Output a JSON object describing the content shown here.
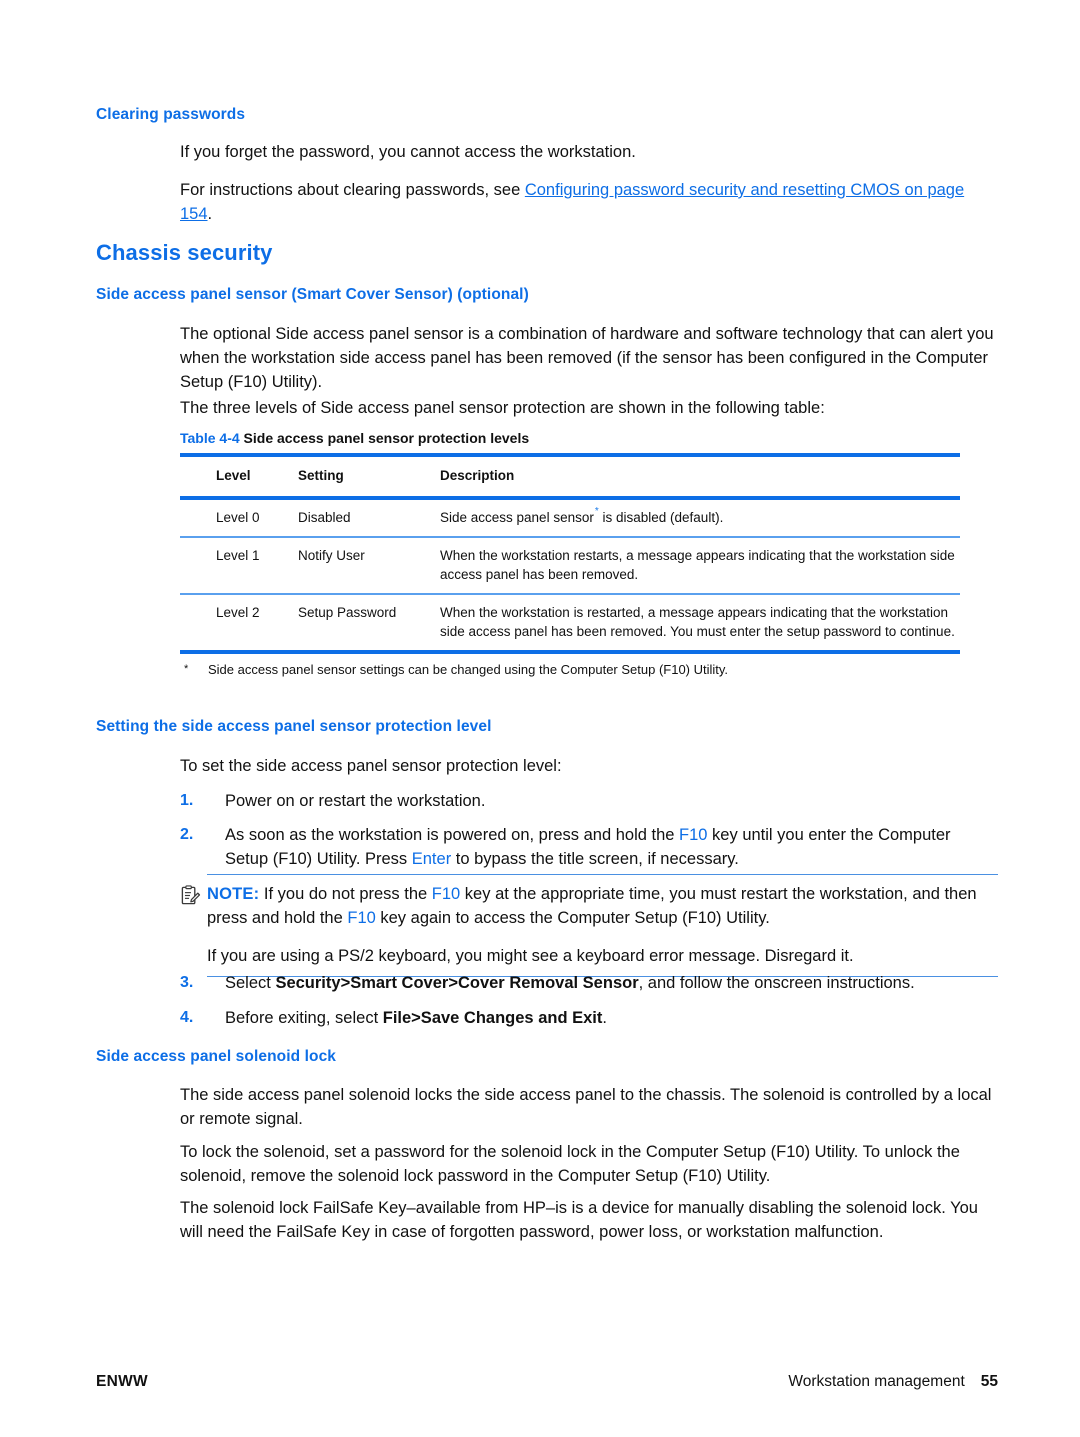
{
  "document": {
    "heading_color": "#0d6ee6",
    "rule_color": "#0d6ee6",
    "thin_rule_color": "#5aa0ee"
  },
  "section_clearing_passwords": {
    "heading": "Clearing passwords",
    "para1": "If you forget the password, you cannot access the workstation.",
    "para2_before": "For instructions about clearing passwords, see ",
    "para2_link": "Configuring password security and resetting CMOS on page 154",
    "para2_after": "."
  },
  "section_chassis_security": {
    "heading": "Chassis security",
    "subheading_sensor": "Side access panel sensor (Smart Cover Sensor) (optional)",
    "para1": "The optional Side access panel sensor is a combination of hardware and software technology that can alert you when the workstation side access panel has been removed (if the sensor has been configured in the Computer Setup (F10) Utility).",
    "para2": "The three levels of Side access panel sensor protection are shown in the following table:"
  },
  "table": {
    "caption_number": "Table 4-4",
    "caption_title": "Side access panel sensor protection levels",
    "columns": [
      "Level",
      "Setting",
      "Description"
    ],
    "rows": [
      {
        "level": "Level 0",
        "setting": "Disabled",
        "description_before": "Side access panel sensor",
        "description_footnote": "*",
        "description_after": " is disabled (default)."
      },
      {
        "level": "Level 1",
        "setting": "Notify User",
        "description_before": "When the workstation restarts, a message appears indicating that the workstation side access panel has been removed.",
        "description_footnote": "",
        "description_after": ""
      },
      {
        "level": "Level 2",
        "setting": "Setup Password",
        "description_before": "When the workstation is restarted, a message appears indicating that the workstation side access panel has been removed. You must enter the setup password to continue.",
        "description_footnote": "",
        "description_after": ""
      }
    ],
    "footnote_marker": "*",
    "footnote_text": "Side access panel sensor settings can be changed using the Computer Setup (F10) Utility."
  },
  "section_setting_level": {
    "subheading": "Setting the side access panel sensor protection level",
    "intro": "To set the side access panel sensor protection level:",
    "steps": [
      {
        "number": "1.",
        "text_1": "Power on or restart the workstation.",
        "key_1": "",
        "text_2": "",
        "key_2": "",
        "text_3": ""
      },
      {
        "number": "2.",
        "text_1": "As soon as the workstation is powered on, press and hold the ",
        "key_1": "F10",
        "text_2": " key until you enter the Computer Setup (F10) Utility. Press ",
        "key_2": "Enter",
        "text_3": " to bypass the title screen, if necessary."
      },
      {
        "number": "3.",
        "text_1": "Select ",
        "bold_1": "Security>Smart Cover>Cover Removal Sensor",
        "text_2": ", and follow the onscreen instructions."
      },
      {
        "number": "4.",
        "text_1": "Before exiting, select ",
        "bold_1": "File>Save Changes and Exit",
        "text_2": "."
      }
    ]
  },
  "note": {
    "icon": "note-clipboard-icon",
    "label": "NOTE:",
    "text_1": " If you do not press the ",
    "key_1": "F10",
    "text_2": " key at the appropriate time, you must restart the workstation, and then press and hold the ",
    "key_2": "F10",
    "text_3": " key again to access the Computer Setup (F10) Utility.",
    "paragraph_2": "If you are using a PS/2 keyboard, you might see a keyboard error message. Disregard it."
  },
  "section_solenoid": {
    "subheading": "Side access panel solenoid lock",
    "para1": "The side access panel solenoid locks the side access panel to the chassis. The solenoid is controlled by a local or remote signal.",
    "para2": "To lock the solenoid, set a password for the solenoid lock in the Computer Setup (F10) Utility. To unlock the solenoid, remove the solenoid lock password in the Computer Setup (F10) Utility.",
    "para3": "The solenoid lock FailSafe Key–available from HP–is is a device for manually disabling the solenoid lock. You will need the FailSafe Key in case of forgotten password, power loss, or workstation malfunction."
  },
  "footer": {
    "left": "ENWW",
    "right_title": "Workstation management",
    "page_number": "55"
  }
}
